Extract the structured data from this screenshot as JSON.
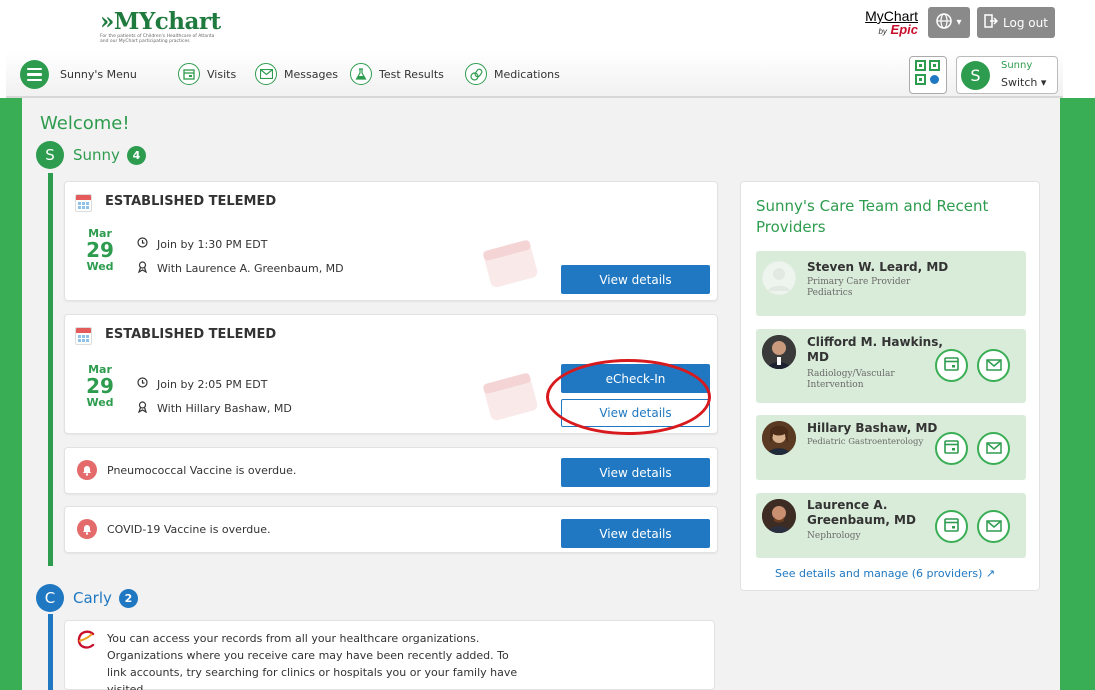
{
  "header": {
    "logo_main": "»MYchart",
    "logo_sub": "For the patients of Children's Healthcare of Atlanta and our MyChart participating practices",
    "mychart_epic_top": "MyChart",
    "mychart_epic_by": "by",
    "mychart_epic_brand": "Epic",
    "logout_label": "Log out"
  },
  "nav": {
    "menu_label": "Sunny's Menu",
    "items": [
      {
        "label": "Visits",
        "icon": "calendar-icon"
      },
      {
        "label": "Messages",
        "icon": "envelope-icon"
      },
      {
        "label": "Test Results",
        "icon": "flask-icon"
      },
      {
        "label": "Medications",
        "icon": "pills-icon"
      }
    ],
    "profile_name": "Sunny",
    "profile_switch": "Switch",
    "profile_initial": "S"
  },
  "main": {
    "welcome": "Welcome!",
    "patients": [
      {
        "initial": "S",
        "name": "Sunny",
        "badge": "4",
        "color": "#2e9c4f"
      },
      {
        "initial": "C",
        "name": "Carly",
        "badge": "2",
        "color": "#1f78c1"
      }
    ],
    "appointments": [
      {
        "title": "ESTABLISHED TELEMED",
        "month": "Mar",
        "day": "29",
        "weekday": "Wed",
        "join": "Join by 1:30 PM EDT",
        "provider": "With Laurence A. Greenbaum, MD",
        "view_label": "View details"
      },
      {
        "title": "ESTABLISHED TELEMED",
        "month": "Mar",
        "day": "29",
        "weekday": "Wed",
        "join": "Join by 2:05 PM EDT",
        "provider": "With Hillary Bashaw, MD",
        "echeckin_label": "eCheck-In",
        "view_label": "View details"
      }
    ],
    "alerts": [
      {
        "text": "Pneumococcal Vaccine is overdue.",
        "button": "View details"
      },
      {
        "text": "COVID-19 Vaccine is overdue.",
        "button": "View details"
      }
    ],
    "info": {
      "text": "You can access your records from all your healthcare organizations. Organizations where you receive care may have been recently added. To link accounts, try searching for clinics or hospitals you or your family have visited."
    }
  },
  "care_team": {
    "title": "Sunny's Care Team and Recent Providers",
    "providers": [
      {
        "name": "Steven W. Leard, MD",
        "role": "Primary Care Provider Pediatrics"
      },
      {
        "name": "Clifford M. Hawkins, MD",
        "role": "Radiology/Vascular Intervention"
      },
      {
        "name": "Hillary Bashaw, MD",
        "role": "Pediatric Gastroenterology"
      },
      {
        "name": "Laurence A. Greenbaum, MD",
        "role": "Nephrology"
      }
    ],
    "see_details": "See details and manage (6 providers)"
  },
  "colors": {
    "brand_green": "#2e9c4f",
    "button_blue": "#1f78c1",
    "alert_red": "#e46b6b",
    "annotation_red": "#d8191d"
  }
}
